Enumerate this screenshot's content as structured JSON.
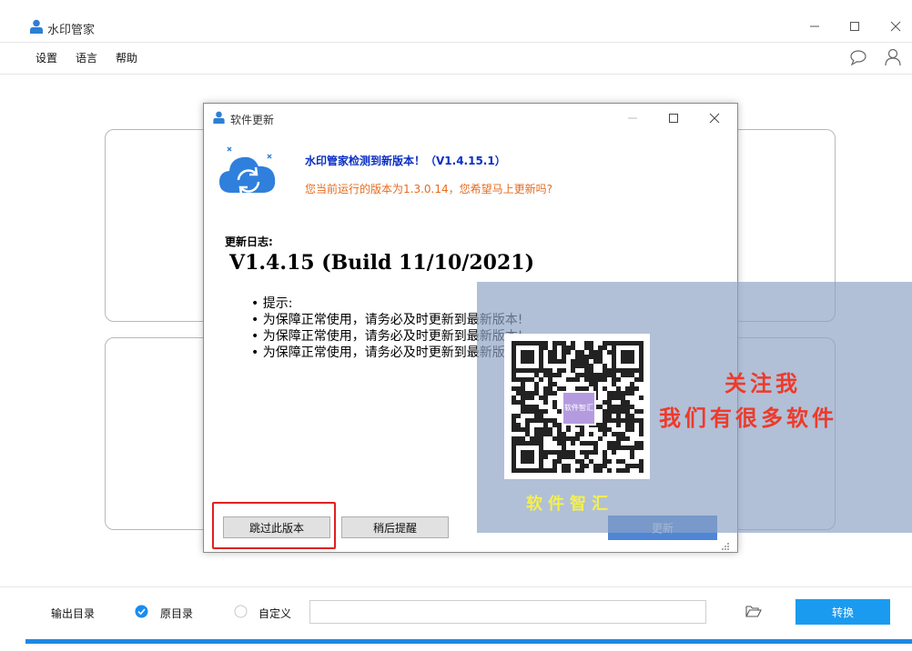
{
  "app": {
    "title": "水印管家"
  },
  "menu": [
    "设置",
    "语言",
    "帮助"
  ],
  "bottom": {
    "output_label": "输出目录",
    "option_original": "原目录",
    "option_custom": "自定义",
    "path_value": "",
    "convert_label": "转换"
  },
  "dialog": {
    "title": "软件更新",
    "headline": "水印管家检测到新版本！（V1.4.15.1）",
    "subline": "您当前运行的版本为1.3.0.14，您希望马上更新吗?",
    "log_label": "更新日志:",
    "version_heading": "V1.4.15 (Build 11/10/2021)",
    "notes": [
      "提示:",
      "为保障正常使用，请务必及时更新到最新版本!",
      "为保障正常使用，请务必及时更新到最新版本!",
      "为保障正常使用，请务必及时更新到最新版本!"
    ],
    "buttons": {
      "skip": "跳过此版本",
      "later": "稍后提醒",
      "update": "更新"
    }
  },
  "overlay": {
    "qr_center_text": "软件智汇",
    "promo_line1": "关注我",
    "promo_line2": "我们有很多软件",
    "brand": "软件智汇"
  },
  "colors": {
    "accent": "#1a9bf0",
    "headline": "#0a2fc4",
    "subline": "#e56b1f",
    "highlight": "#e02020",
    "promo": "#ee3a2a",
    "brand": "#f5f04a"
  }
}
